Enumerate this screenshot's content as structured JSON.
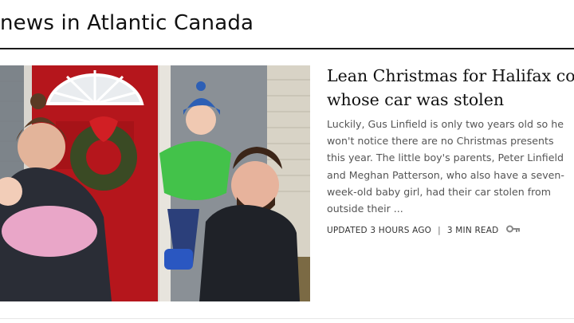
{
  "section": {
    "title": "news in Atlantic Canada"
  },
  "article": {
    "headline_lines": [
      "Lean Christmas for Halifax couple",
      "whose car was stolen"
    ],
    "summary_lines": [
      "Luckily, Gus Linfield is only two years old so he",
      "won't notice there are no Christmas presents",
      "this year. The little boy's parents, Peter Linfield",
      "and Meghan Patterson, who also have a seven-",
      "week-old baby girl, had their car stolen from",
      "outside their ..."
    ],
    "updated": "UPDATED 3 HOURS AGO",
    "separator": "|",
    "read_time": "3 MIN READ",
    "premium_icon": "key-icon"
  }
}
